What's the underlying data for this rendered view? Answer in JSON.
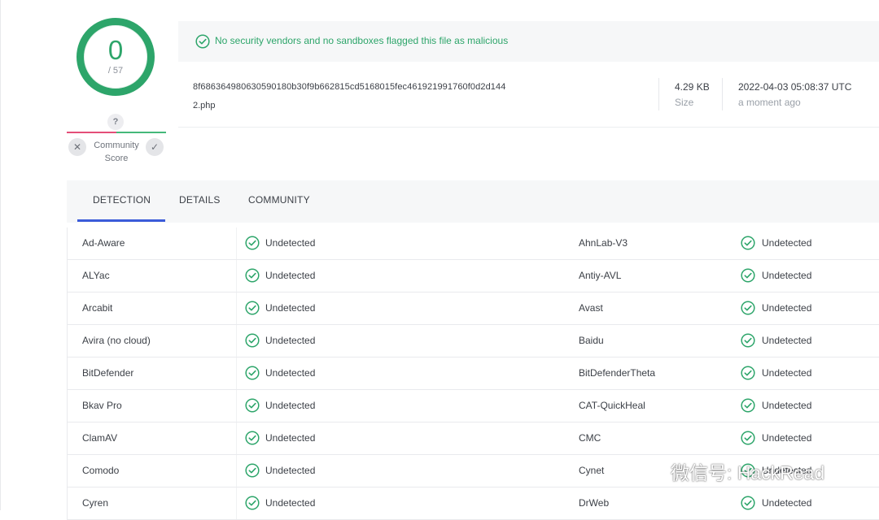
{
  "score": {
    "detections": "0",
    "total": "/ 57"
  },
  "community": {
    "badge": "?",
    "label_line1": "Community",
    "label_line2": "Score"
  },
  "banner": {
    "message": "No security vendors and no sandboxes flagged this file as malicious"
  },
  "file": {
    "hash": "8f686364980630590180b30f9b662815cd5168015fec461921991760f0d2d144",
    "name": "2.php",
    "size_value": "4.29 KB",
    "size_label": "Size",
    "date_value": "2022-04-03 05:08:37 UTC",
    "date_label": "a moment ago"
  },
  "tabs": [
    {
      "label": "DETECTION",
      "active": true
    },
    {
      "label": "DETAILS",
      "active": false
    },
    {
      "label": "COMMUNITY",
      "active": false
    }
  ],
  "rows": [
    {
      "left_engine": "Ad-Aware",
      "left_result": "Undetected",
      "right_engine": "AhnLab-V3",
      "right_result": "Undetected"
    },
    {
      "left_engine": "ALYac",
      "left_result": "Undetected",
      "right_engine": "Antiy-AVL",
      "right_result": "Undetected"
    },
    {
      "left_engine": "Arcabit",
      "left_result": "Undetected",
      "right_engine": "Avast",
      "right_result": "Undetected"
    },
    {
      "left_engine": "Avira (no cloud)",
      "left_result": "Undetected",
      "right_engine": "Baidu",
      "right_result": "Undetected"
    },
    {
      "left_engine": "BitDefender",
      "left_result": "Undetected",
      "right_engine": "BitDefenderTheta",
      "right_result": "Undetected"
    },
    {
      "left_engine": "Bkav Pro",
      "left_result": "Undetected",
      "right_engine": "CAT-QuickHeal",
      "right_result": "Undetected"
    },
    {
      "left_engine": "ClamAV",
      "left_result": "Undetected",
      "right_engine": "CMC",
      "right_result": "Undetected"
    },
    {
      "left_engine": "Comodo",
      "left_result": "Undetected",
      "right_engine": "Cynet",
      "right_result": "Undetected"
    },
    {
      "left_engine": "Cyren",
      "left_result": "Undetected",
      "right_engine": "DrWeb",
      "right_result": "Undetected"
    }
  ],
  "watermark": {
    "text": "微信号: HackRead"
  },
  "colors": {
    "clean_green": "#2da56a",
    "tab_accent": "#3b5bd9",
    "malicious_red": "#e44e78"
  }
}
